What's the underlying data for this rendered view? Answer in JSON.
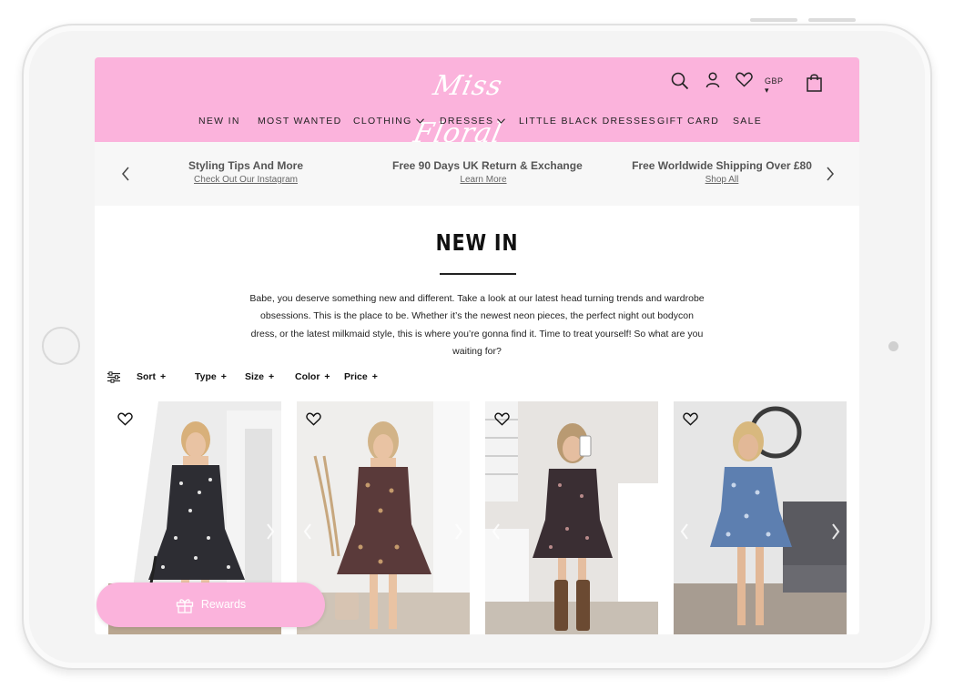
{
  "colors": {
    "header_pink": "#fbb3dc",
    "infobar_gray": "#f7f7f7",
    "text_dark": "#222222"
  },
  "header": {
    "logo_text": "Miss Floral",
    "icons": [
      "search-icon",
      "account-icon",
      "wishlist-heart-icon",
      "cart-bag-icon"
    ],
    "currency": "GBP ▾"
  },
  "nav": {
    "items": [
      {
        "label": "NEW IN"
      },
      {
        "label": "MOST WANTED"
      },
      {
        "label": "CLOTHING"
      },
      {
        "label": "DRESSES"
      },
      {
        "label": "LITTLE BLACK DRESSES"
      },
      {
        "label": "GIFT CARD"
      },
      {
        "label": "SALE"
      }
    ]
  },
  "infobar": {
    "items": [
      {
        "title": "Styling Tips And More",
        "link": "Check Out Our Instagram"
      },
      {
        "title": "Free 90 Days UK Return & Exchange",
        "link": "Learn More"
      },
      {
        "title": "Free Worldwide Shipping Over £80",
        "link": "Shop All"
      }
    ]
  },
  "main": {
    "title": "NEW IN",
    "description": "Babe, you deserve something new and different. Take a look at our latest head turning trends and wardrobe obsessions. This is the place to be. Whether it’s the newest neon pieces, the perfect night out bodycon dress, or the latest milkmaid style, this is where you’re gonna find it. Time to treat yourself! So what are you waiting for?"
  },
  "filters": {
    "items": [
      {
        "label": "Sort"
      },
      {
        "label": "Type"
      },
      {
        "label": "Size"
      },
      {
        "label": "Color"
      },
      {
        "label": "Price"
      }
    ]
  },
  "products": [
    {
      "dress_color": "#2d2d33",
      "pattern": "#e6e6e6"
    },
    {
      "dress_color": "#5a3a3a",
      "pattern": "#c49a6c"
    },
    {
      "dress_color": "#3a2e33",
      "pattern": "#b88a8a"
    },
    {
      "dress_color": "#5d7fb0",
      "pattern": "#c8d6ea"
    }
  ],
  "rewards": {
    "label": "Rewards"
  }
}
